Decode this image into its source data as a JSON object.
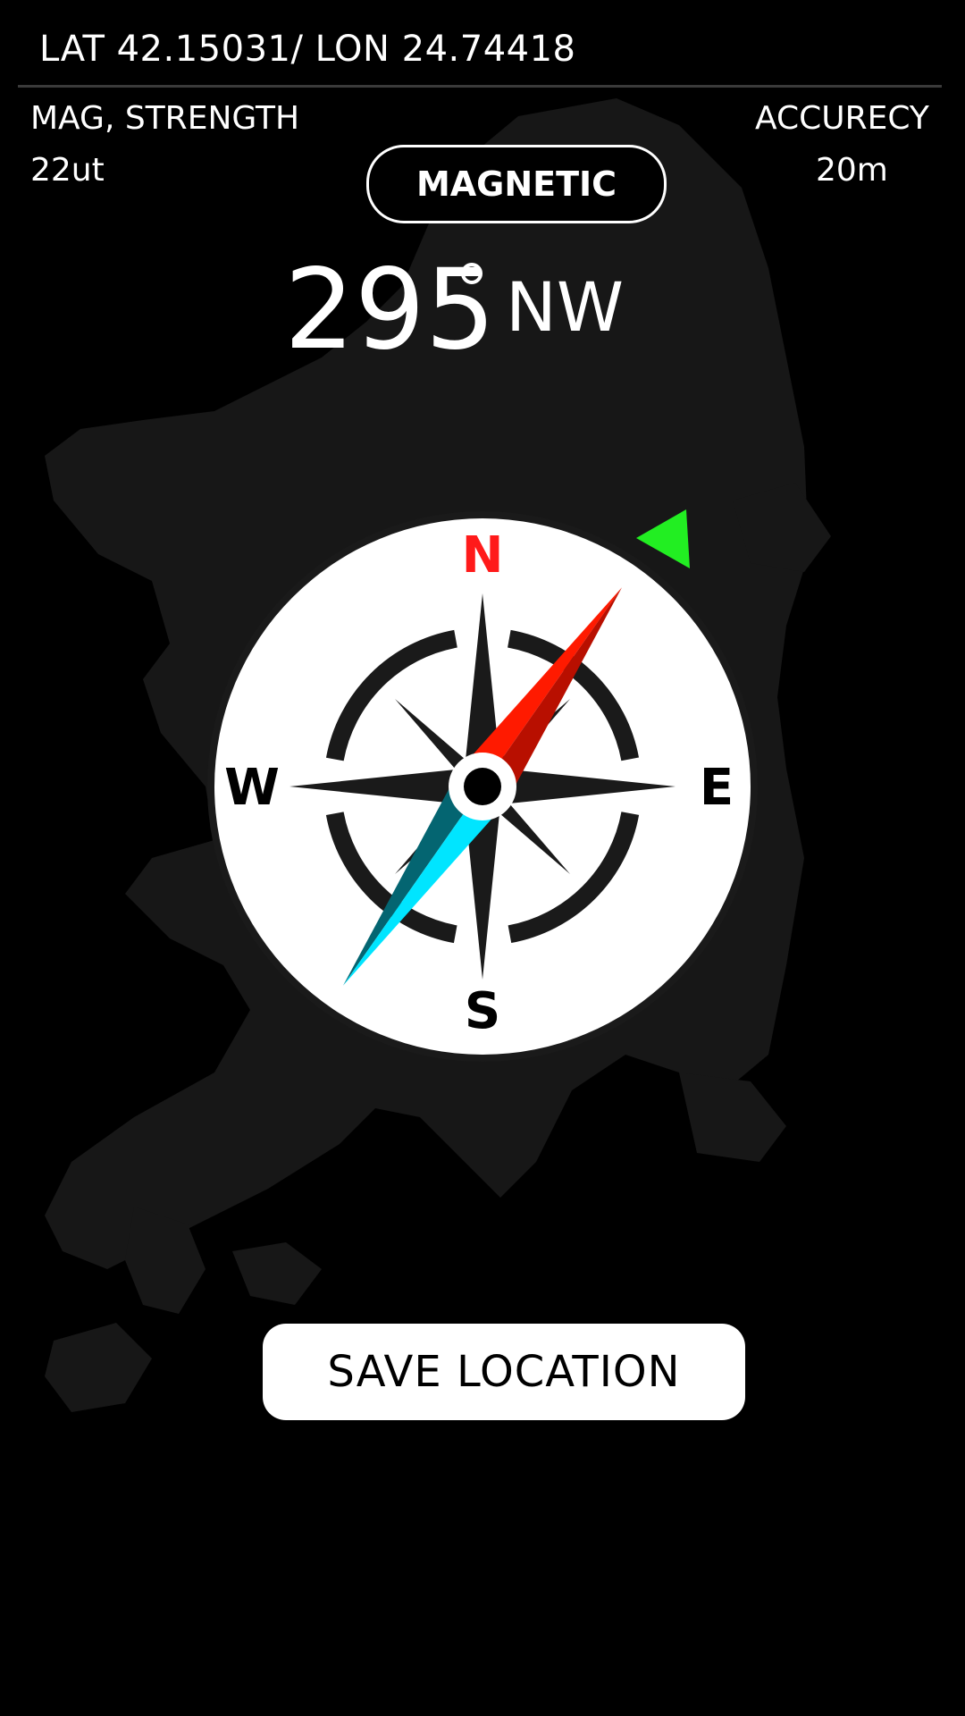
{
  "location": {
    "coordinates_text": "LAT 42.15031/ LON 24.74418"
  },
  "magnetic_strength": {
    "label": "MAG, STRENGTH",
    "value": "22ut"
  },
  "accuracy": {
    "label": "ACCURECY",
    "value": "20m"
  },
  "mode_button": {
    "label": "MAGNETIC"
  },
  "heading": {
    "degrees": "295",
    "direction": "NW"
  },
  "compass": {
    "north": "N",
    "south": "S",
    "east": "E",
    "west": "W",
    "needle_angle_deg": 35,
    "colors": {
      "north_label": "#ff1a1a",
      "needle_north": "#ff1a00",
      "needle_north_dark": "#b80f00",
      "needle_south": "#00e5ff",
      "needle_south_dark": "#046571",
      "bearing_marker": "#22ee22"
    }
  },
  "save_button": {
    "label": "SAVE LOCATION"
  }
}
